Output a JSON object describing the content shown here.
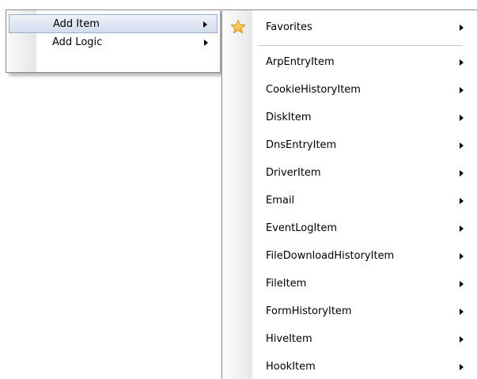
{
  "main_menu": {
    "items": [
      {
        "label": "Add Item",
        "has_submenu": true,
        "highlighted": true
      },
      {
        "label": "Add Logic",
        "has_submenu": true,
        "highlighted": false
      }
    ]
  },
  "submenu": {
    "favorites": {
      "label": "Favorites",
      "icon": "star-icon",
      "icon_color": "#f5b22e"
    },
    "items": [
      {
        "label": "ArpEntryItem"
      },
      {
        "label": "CookieHistoryItem"
      },
      {
        "label": "DiskItem"
      },
      {
        "label": "DnsEntryItem"
      },
      {
        "label": "DriverItem"
      },
      {
        "label": "Email"
      },
      {
        "label": "EventLogItem"
      },
      {
        "label": "FileDownloadHistoryItem"
      },
      {
        "label": "FileItem"
      },
      {
        "label": "FormHistoryItem"
      },
      {
        "label": "HiveItem"
      },
      {
        "label": "HookItem"
      }
    ]
  }
}
